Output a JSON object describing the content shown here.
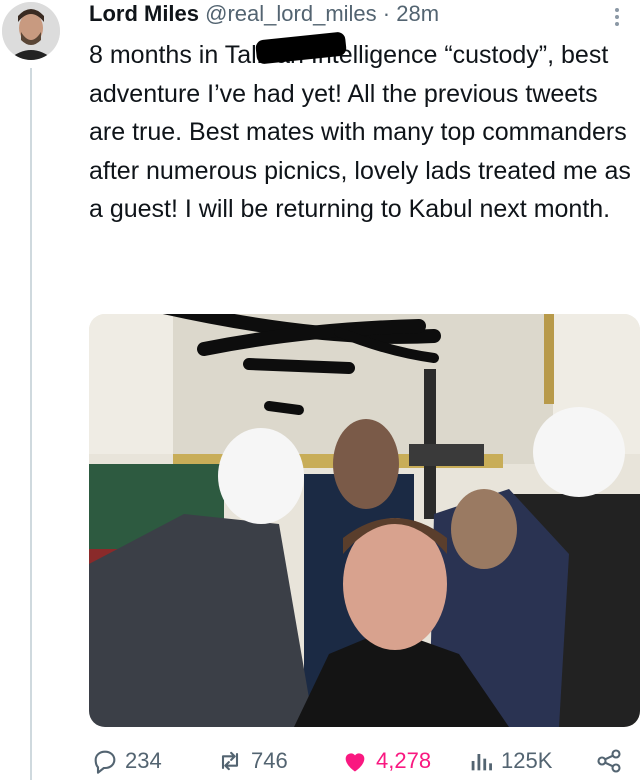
{
  "tweet": {
    "author_name": "Lord Miles",
    "handle": "@real_lord_miles",
    "separator": "·",
    "time": "28m",
    "text": "8 months in Taliban Intelligence “custody”, best adventure I’ve had yet! All the previous tweets are true. Best mates with many top commanders after numerous picnics, lovely lads treated me as a guest! I will be returning to Kabul next month."
  },
  "actions": {
    "replies": "234",
    "retweets": "746",
    "likes": "4,278",
    "views": "125K"
  },
  "colors": {
    "text": "#0f1419",
    "muted": "#536471",
    "like": "#f91880",
    "thread_line": "#cfd9de"
  },
  "icons": [
    "reply-icon",
    "retweet-icon",
    "heart-icon",
    "views-icon",
    "share-icon",
    "more-icon"
  ]
}
